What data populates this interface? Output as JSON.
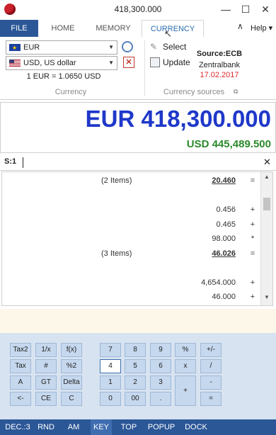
{
  "window": {
    "title": "418,300.000"
  },
  "ribbon": {
    "file_tab": "FILE",
    "tabs": [
      "HOME",
      "MEMORY",
      "CURRENCY"
    ],
    "help_label": "Help",
    "currency_from": "EUR",
    "currency_to": "USD, US dollar",
    "rate_text": "1 EUR = 1.0650 USD",
    "group_currency": "Currency",
    "select_label": "Select",
    "update_label": "Update",
    "source_label": "Source:ECB",
    "source_name": "Zentralbank",
    "source_date": "17.02.2017",
    "group_sources": "Currency sources"
  },
  "display": {
    "main": "EUR 418,300.000",
    "secondary": "USD 445,489.500"
  },
  "tape": {
    "tab_label": "S:1",
    "rows": [
      {
        "note": "(2 Items)",
        "value": "20.460",
        "op": "=",
        "total": true
      },
      {
        "note": "",
        "value": "",
        "op": ""
      },
      {
        "note": "",
        "value": "0.456",
        "op": "+"
      },
      {
        "note": "",
        "value": "0.465",
        "op": "+"
      },
      {
        "note": "",
        "value": "98.000",
        "op": "*"
      },
      {
        "note": "(3 Items)",
        "value": "46.026",
        "op": "=",
        "total": true
      },
      {
        "note": "",
        "value": "",
        "op": ""
      },
      {
        "note": "",
        "value": "4,654.000",
        "op": "+"
      },
      {
        "note": "",
        "value": "46.000",
        "op": "+"
      }
    ]
  },
  "keypad": {
    "left": [
      [
        "Tax2",
        "1/x",
        "f(x)"
      ],
      [
        "Tax",
        "#",
        "%2"
      ],
      [
        "A",
        "GT",
        "Delta"
      ],
      [
        "<-",
        "CE",
        "C"
      ]
    ],
    "num": [
      [
        "7",
        "8",
        "9",
        "%",
        "+/-"
      ],
      [
        "4",
        "5",
        "6",
        "x",
        "/"
      ],
      [
        "1",
        "2",
        "3",
        "+",
        "-"
      ],
      [
        "0",
        "00",
        ".",
        "",
        "="
      ]
    ]
  },
  "statusbar": {
    "items": [
      "DEC.:3",
      "RND",
      "AM",
      "KEY",
      "TOP",
      "POPUP",
      "DOCK"
    ]
  },
  "colors": {
    "accent": "#2b5797",
    "display_main": "#1f38c9",
    "display_secondary": "#2a8a2a",
    "date_red": "#e0262b"
  }
}
